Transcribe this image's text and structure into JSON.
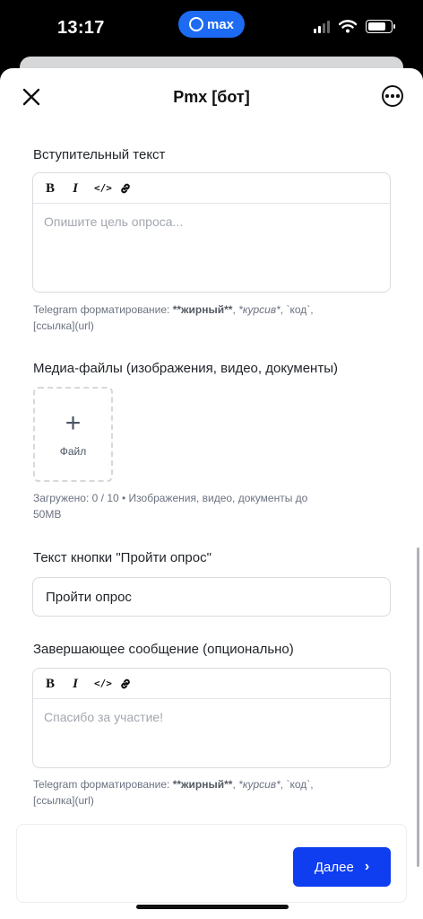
{
  "status": {
    "time": "13:17",
    "pill_label": "max"
  },
  "nav": {
    "title": "Pmx [бот]"
  },
  "intro": {
    "label": "Вступительный текст",
    "toolbar": {
      "bold": "B",
      "italic": "I",
      "code": "</>"
    },
    "placeholder": "Опишите цель опроса...",
    "hint_prefix": "Telegram форматирование: ",
    "hint_bold": "**жирный**",
    "hint_sep1": ", ",
    "hint_italic": "*курсив*",
    "hint_rest": ", `код`,",
    "hint_line2": "[ссылка](url)"
  },
  "media": {
    "label": "Медиа-файлы (изображения, видео, документы)",
    "dropzone_label": "Файл",
    "hint_line1": "Загружено: 0 / 10 • Изображения, видео, документы до",
    "hint_line2": "50MB"
  },
  "button_text": {
    "label": "Текст кнопки \"Пройти опрос\"",
    "value": "Пройти опрос"
  },
  "closing": {
    "label": "Завершающее сообщение (опционально)",
    "toolbar": {
      "bold": "B",
      "italic": "I",
      "code": "</>"
    },
    "placeholder": "Спасибо за участие!",
    "hint_prefix": "Telegram форматирование: ",
    "hint_bold": "**жирный**",
    "hint_sep1": ", ",
    "hint_italic": "*курсив*",
    "hint_rest": ", `код`,",
    "hint_line2": "[ссылка](url)"
  },
  "footer": {
    "next_label": "Далее"
  },
  "colors": {
    "accent": "#0f3df0",
    "max_brand": "#1d6bf3"
  }
}
